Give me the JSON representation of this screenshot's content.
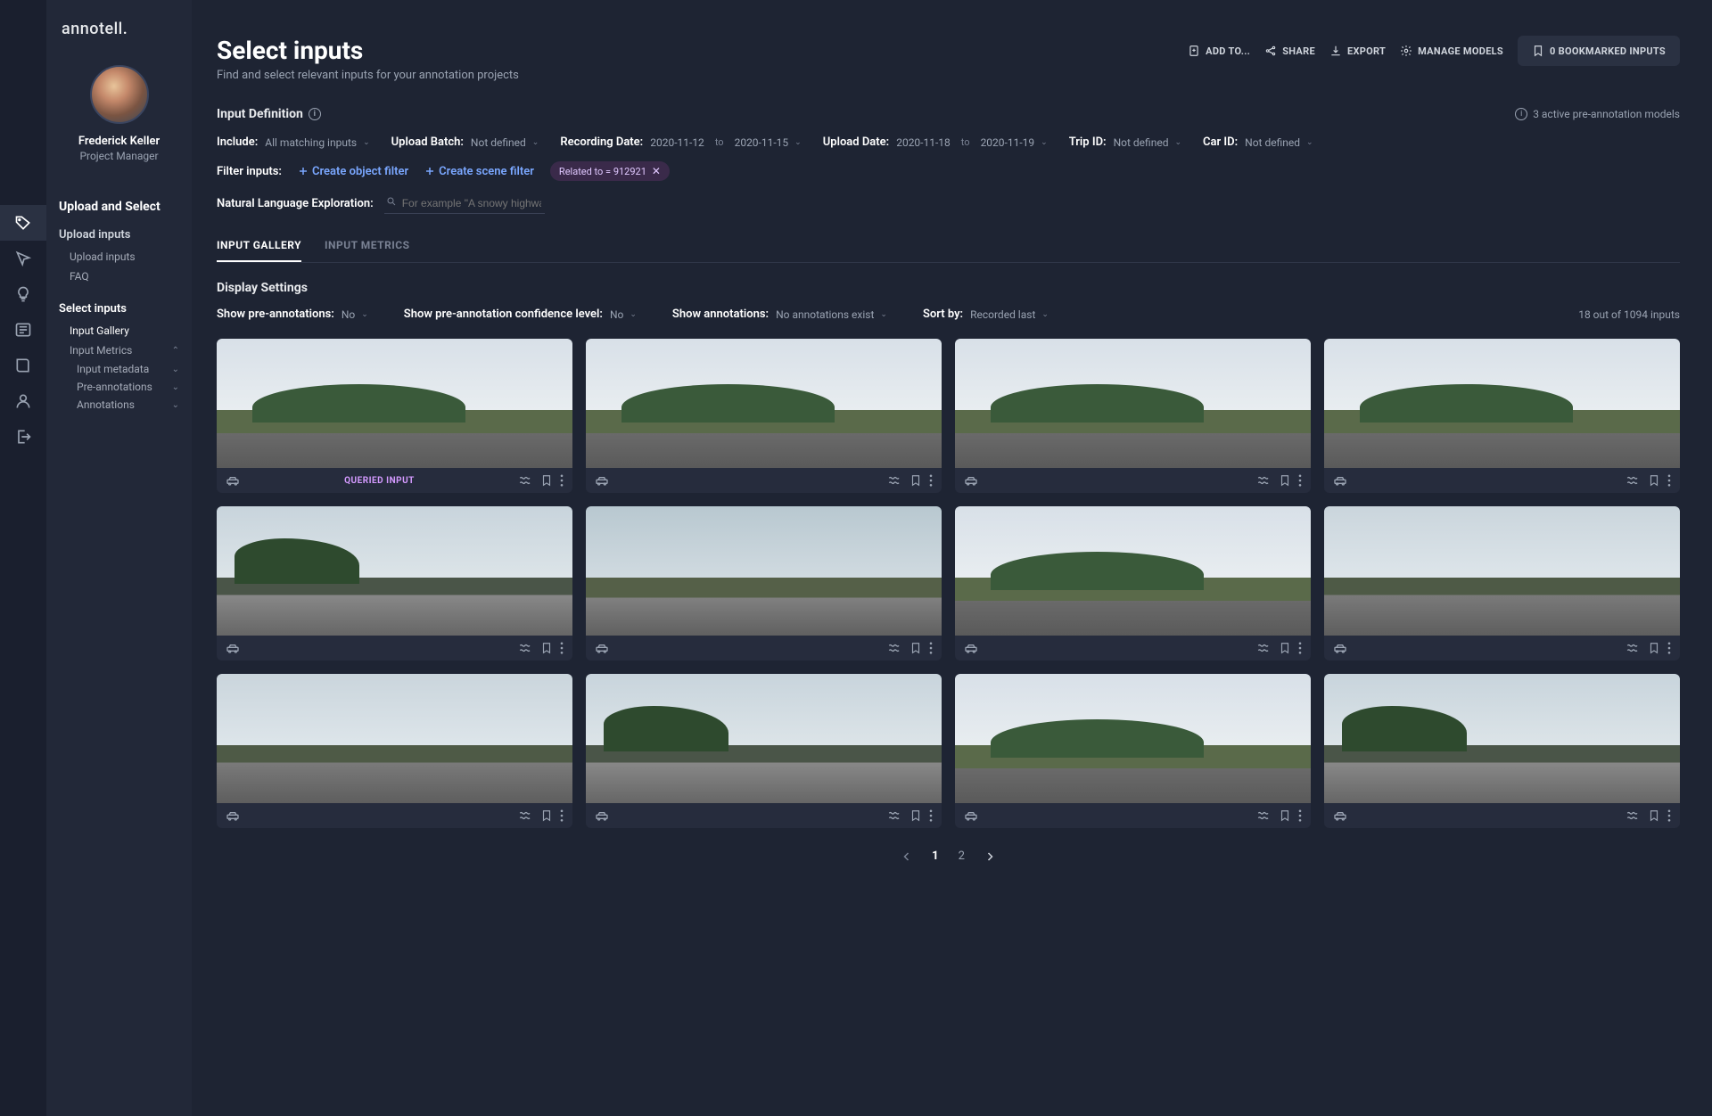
{
  "brand": "annotell",
  "user": {
    "name": "Frederick Keller",
    "role": "Project Manager"
  },
  "sidebar": {
    "section": "Upload and Select",
    "upload": "Upload inputs",
    "upload_sub1": "Upload inputs",
    "upload_sub2": "FAQ",
    "select": "Select inputs",
    "sel_gallery": "Input Gallery",
    "sel_metrics": "Input Metrics",
    "sel_meta": "Input metadata",
    "sel_preann": "Pre-annotations",
    "sel_ann": "Annotations"
  },
  "page": {
    "title": "Select inputs",
    "subtitle": "Find and select relevant inputs for your annotation projects"
  },
  "actions": {
    "addto": "ADD TO...",
    "share": "SHARE",
    "export": "EXPORT",
    "manage": "MANAGE MODELS",
    "bookmarked": "0 BOOKMARKED INPUTS"
  },
  "definition": {
    "title": "Input Definition",
    "models_info": "3 active pre-annotation models",
    "include_label": "Include:",
    "include_val": "All matching inputs",
    "uploadbatch_label": "Upload Batch:",
    "uploadbatch_val": "Not defined",
    "recdate_label": "Recording Date:",
    "recdate_from": "2020-11-12",
    "recdate_to": "2020-11-15",
    "updldate_label": "Upload Date:",
    "updldate_from": "2020-11-18",
    "updldate_to": "2020-11-19",
    "tripid_label": "Trip ID:",
    "tripid_val": "Not defined",
    "carid_label": "Car ID:",
    "carid_val": "Not defined",
    "to": "to",
    "filter_label": "Filter inputs:",
    "create_obj": "Create object filter",
    "create_scene": "Create scene filter",
    "chip": "Related to = 912921",
    "nle_label": "Natural Language Exploration:",
    "nle_placeholder": "For example \"A snowy highway\""
  },
  "tabs": {
    "gallery": "INPUT GALLERY",
    "metrics": "INPUT METRICS"
  },
  "display": {
    "title": "Display Settings",
    "preann_label": "Show pre-annotations:",
    "preann_val": "No",
    "conf_label": "Show pre-annotation confidence level:",
    "conf_val": "No",
    "ann_label": "Show annotations:",
    "ann_val": "No annotations exist",
    "sort_label": "Sort by:",
    "sort_val": "Recorded last",
    "count": "18 out of 1094 inputs"
  },
  "card": {
    "queried": "QUERIED INPUT"
  },
  "pagination": {
    "p1": "1",
    "p2": "2"
  }
}
